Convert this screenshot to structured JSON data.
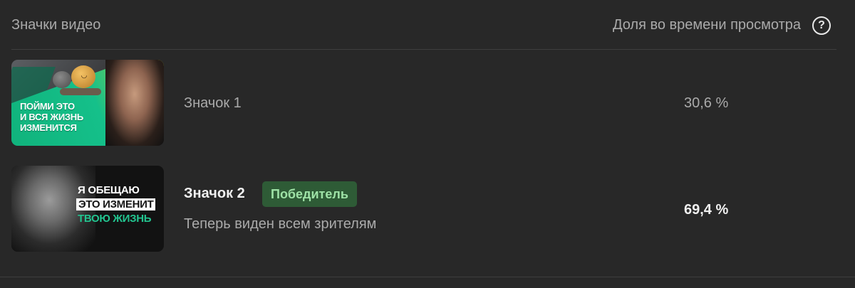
{
  "header": {
    "left_label": "Значки видео",
    "right_label": "Доля во времени просмотра",
    "help_icon": "?"
  },
  "thumbnails": [
    {
      "name": "Значок 1",
      "share": "30,6 %",
      "thumb_text": [
        "ПОЙМИ ЭТО",
        "И ВСЯ ЖИЗНЬ",
        "ИЗМЕНИТСЯ"
      ]
    },
    {
      "name": "Значок 2",
      "badge": "Победитель",
      "subtitle": "Теперь виден всем зрителям",
      "share": "69,4 %",
      "thumb_text": [
        "Я ОБЕЩАЮ",
        "ЭТО ИЗМЕНИТ",
        "ТВОЮ ЖИЗНЬ"
      ]
    }
  ],
  "colors": {
    "background": "#282828",
    "badge_bg": "#2e5b36",
    "badge_text": "#9ee2a6",
    "accent_green": "#22c48f"
  }
}
